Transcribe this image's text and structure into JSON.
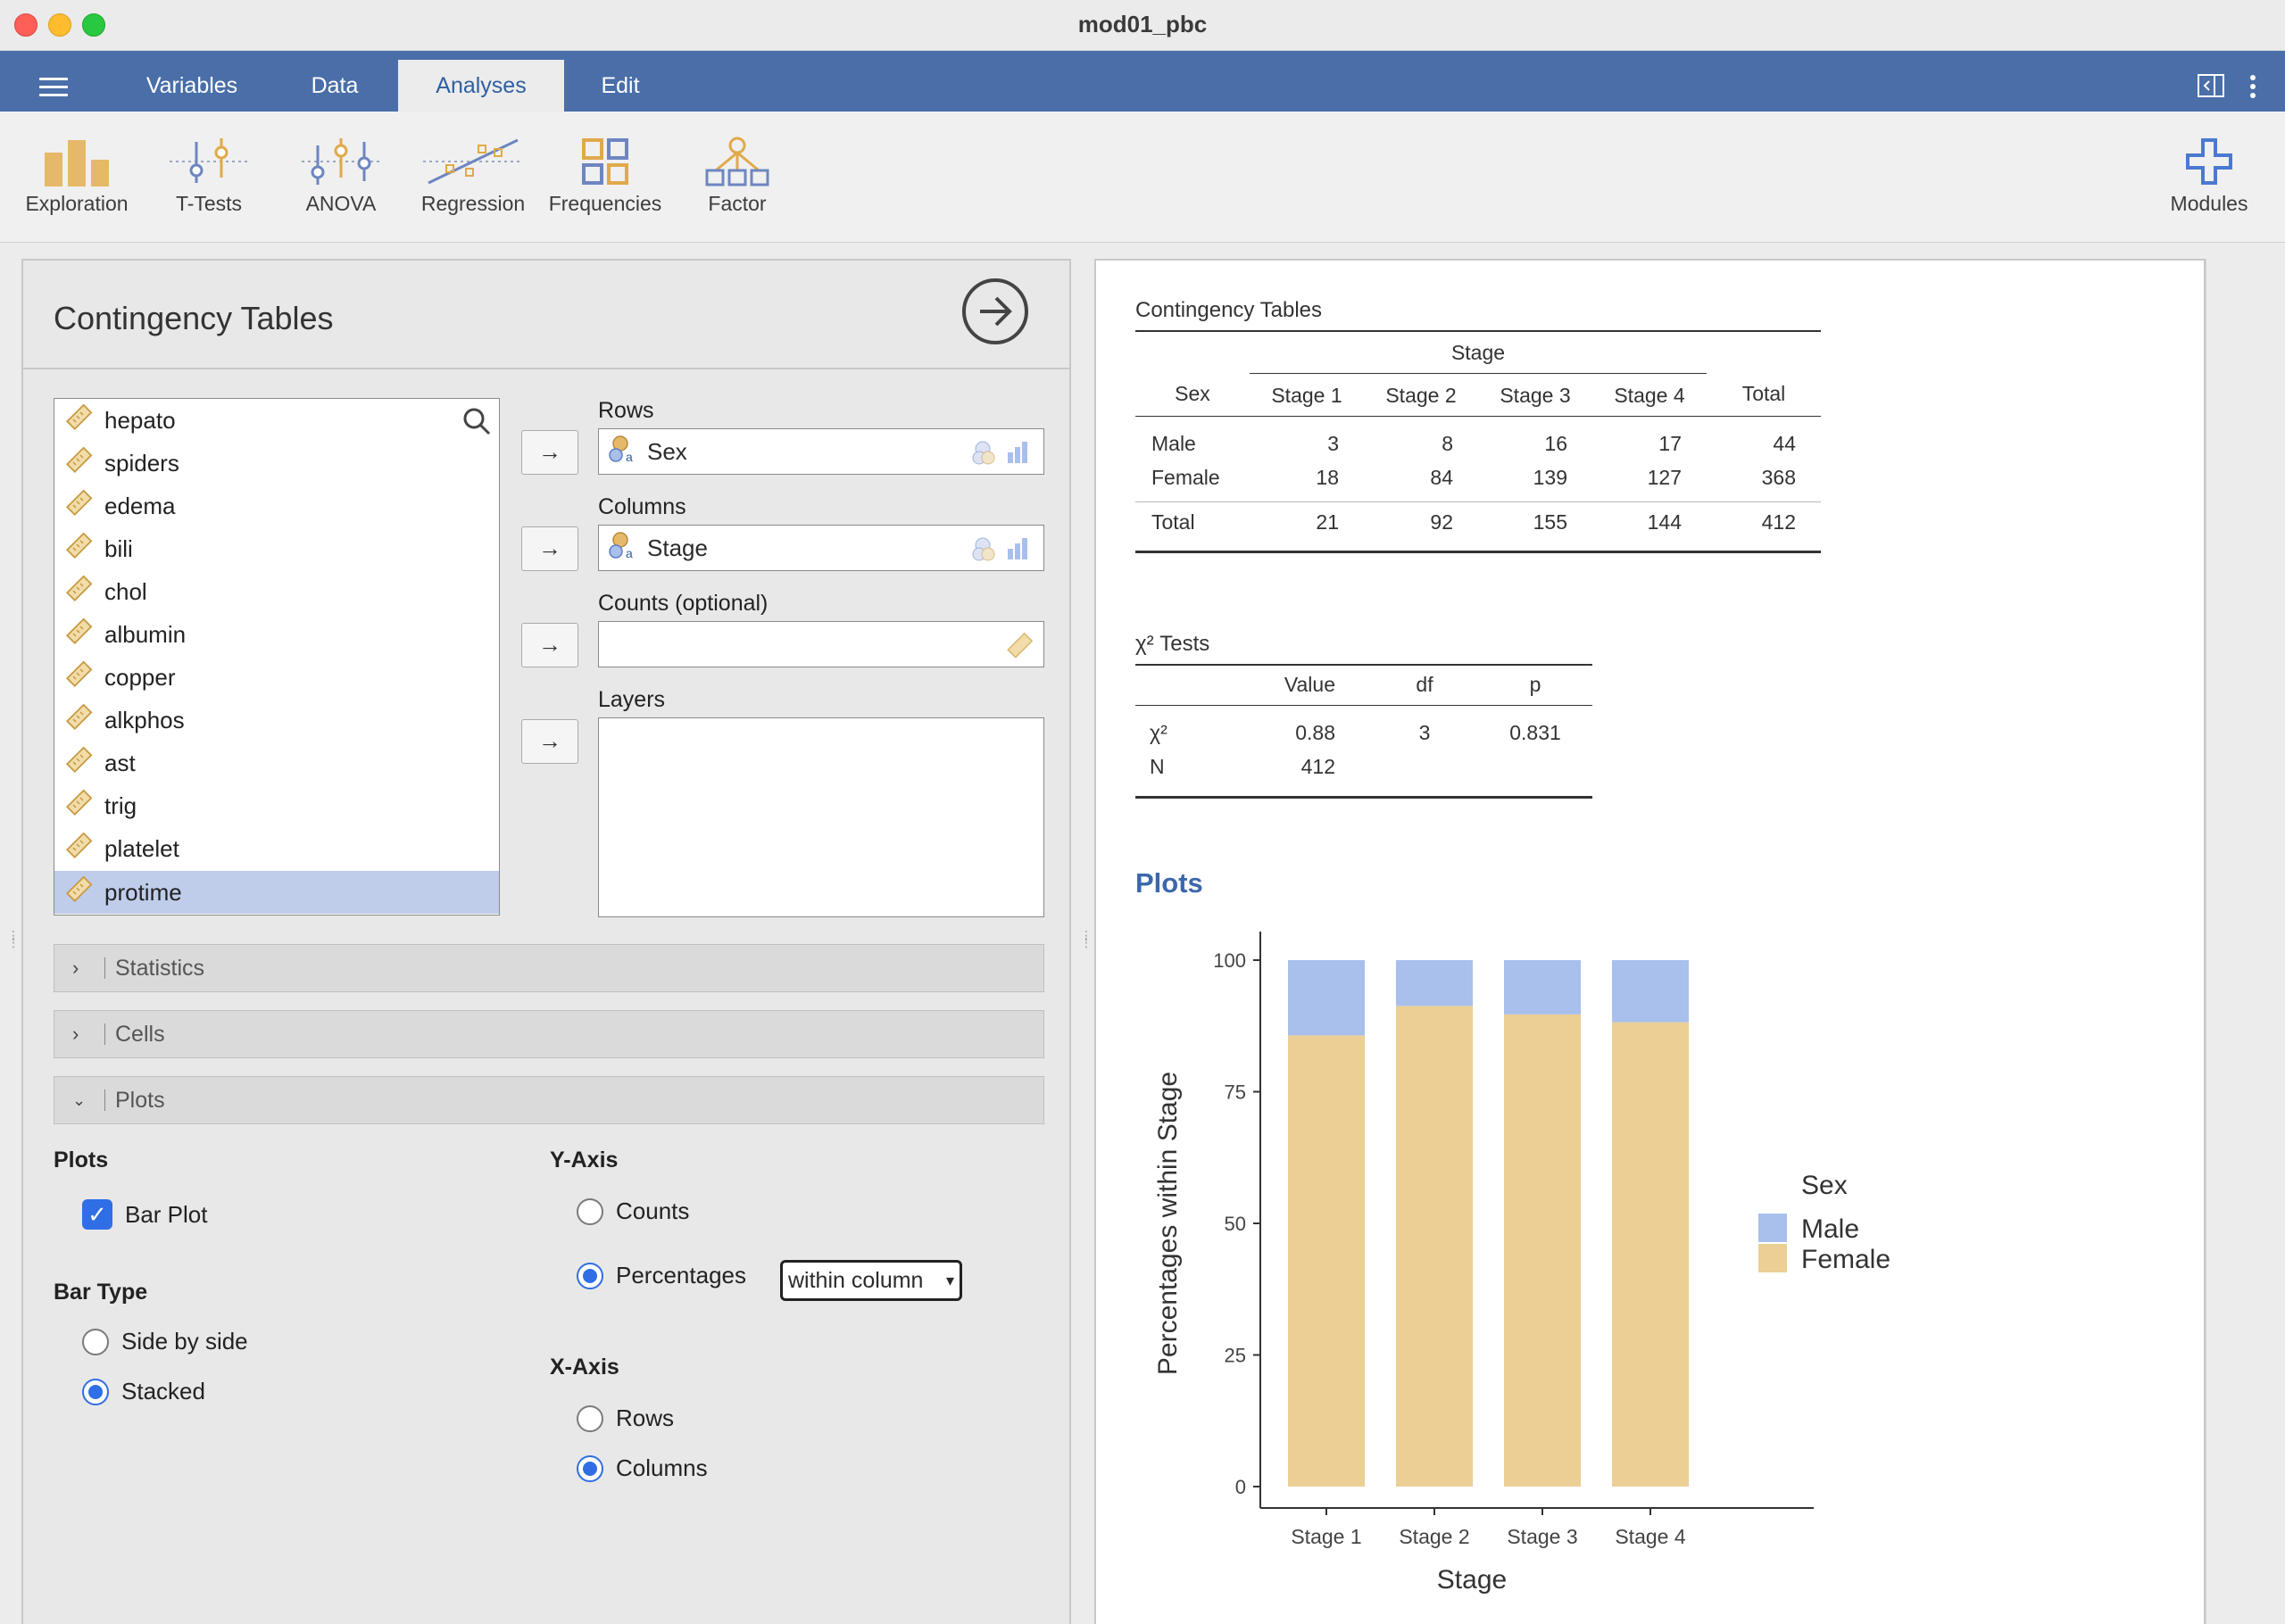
{
  "window": {
    "title": "mod01_pbc"
  },
  "tabs": [
    "Variables",
    "Data",
    "Analyses",
    "Edit"
  ],
  "active_tab": "Analyses",
  "ribbon": {
    "tools": [
      "Exploration",
      "T-Tests",
      "ANOVA",
      "Regression",
      "Frequencies",
      "Factor"
    ],
    "modules_label": "Modules"
  },
  "options": {
    "title": "Contingency Tables",
    "variables": [
      "hepato",
      "spiders",
      "edema",
      "bili",
      "chol",
      "albumin",
      "copper",
      "alkphos",
      "ast",
      "trig",
      "platelet",
      "protime"
    ],
    "selected_variable": "protime",
    "targets": {
      "rows_label": "Rows",
      "rows_value": "Sex",
      "columns_label": "Columns",
      "columns_value": "Stage",
      "counts_label": "Counts (optional)",
      "layers_label": "Layers"
    },
    "sections": {
      "statistics": "Statistics",
      "cells": "Cells",
      "plots": "Plots"
    },
    "plots": {
      "plots_heading": "Plots",
      "bar_plot_label": "Bar Plot",
      "bar_plot_checked": true,
      "bar_type_heading": "Bar Type",
      "side_by_side_label": "Side by side",
      "stacked_label": "Stacked",
      "bar_type_selected": "Stacked",
      "y_axis_heading": "Y-Axis",
      "counts_label": "Counts",
      "percentages_label": "Percentages",
      "y_axis_selected": "Percentages",
      "percent_option": "within column",
      "x_axis_heading": "X-Axis",
      "rows_label": "Rows",
      "columns_label": "Columns",
      "x_axis_selected": "Columns"
    }
  },
  "results": {
    "contingency": {
      "title": "Contingency Tables",
      "group_header": "Stage",
      "columns": [
        "Sex",
        "Stage 1",
        "Stage 2",
        "Stage 3",
        "Stage 4",
        "Total"
      ],
      "rows": [
        [
          "Male",
          "3",
          "8",
          "16",
          "17",
          "44"
        ],
        [
          "Female",
          "18",
          "84",
          "139",
          "127",
          "368"
        ],
        [
          "Total",
          "21",
          "92",
          "155",
          "144",
          "412"
        ]
      ]
    },
    "chisq": {
      "title": "χ² Tests",
      "columns": [
        "",
        "Value",
        "df",
        "p"
      ],
      "rows": [
        [
          "χ²",
          "0.88",
          "3",
          "0.831"
        ],
        [
          "N",
          "412",
          "",
          ""
        ]
      ]
    },
    "plots_heading": "Plots"
  },
  "colors": {
    "accent": "#4a6ea8",
    "male": "#a9bfec",
    "female": "#ebcf95",
    "plots_heading": "#3b68ac"
  },
  "chart_data": {
    "type": "bar",
    "stacked": true,
    "categories": [
      "Stage 1",
      "Stage 2",
      "Stage 3",
      "Stage 4"
    ],
    "series": [
      {
        "name": "Female",
        "values": [
          85.7,
          91.3,
          89.7,
          88.2
        ]
      },
      {
        "name": "Male",
        "values": [
          14.3,
          8.7,
          10.3,
          11.8
        ]
      }
    ],
    "xlabel": "Stage",
    "ylabel": "Percentages within Stage",
    "ylim": [
      0,
      100
    ],
    "yticks": [
      0,
      25,
      50,
      75,
      100
    ],
    "legend_title": "Sex",
    "legend_entries": [
      "Male",
      "Female"
    ],
    "legend_position": "right",
    "grid": false
  }
}
